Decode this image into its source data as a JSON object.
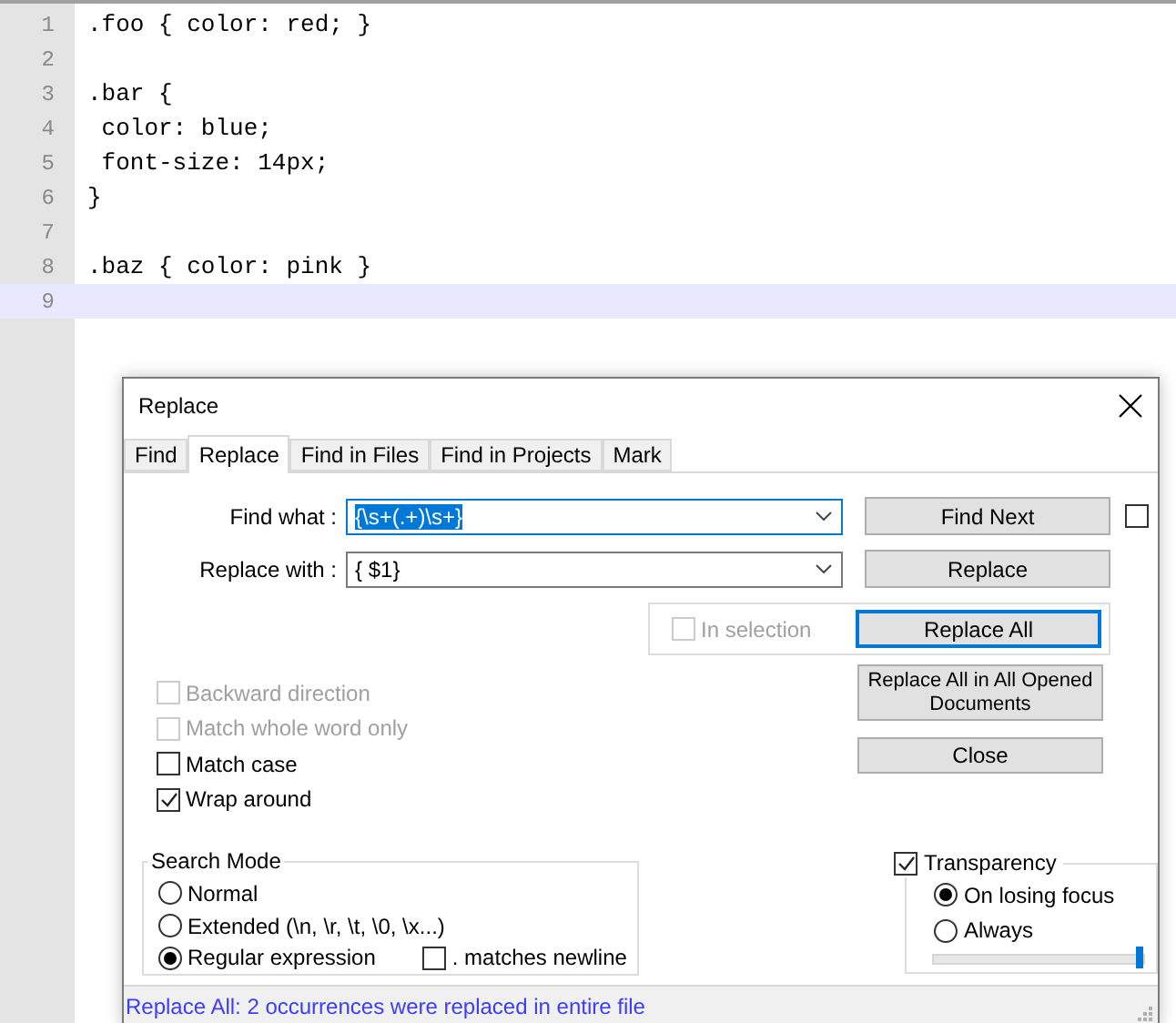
{
  "editor": {
    "lines": [
      {
        "number": "1",
        "text": ".foo { color: red; }",
        "current": false
      },
      {
        "number": "2",
        "current": false
      },
      {
        "number": "3",
        "text": ".bar {",
        "current": false
      },
      {
        "number": "4",
        "text": " color: blue;",
        "current": false
      },
      {
        "number": "5",
        "text": " font-size: 14px;",
        "current": false
      },
      {
        "number": "6",
        "text": "}",
        "current": false
      },
      {
        "number": "7",
        "current": false
      },
      {
        "number": "8",
        "text": ".baz { color: pink }",
        "current": false
      },
      {
        "number": "9",
        "current": true
      }
    ]
  },
  "dialog": {
    "title": "Replace",
    "tabs": [
      {
        "label": "Find",
        "selected": false
      },
      {
        "label": "Replace",
        "selected": true
      },
      {
        "label": "Find in Files",
        "selected": false
      },
      {
        "label": "Find in Projects",
        "selected": false
      },
      {
        "label": "Mark",
        "selected": false
      }
    ],
    "fields": [
      {
        "label": "Find what :",
        "value": "{\\s+(.+)\\s+}",
        "focused": true
      },
      {
        "label": "Replace with :",
        "value": "{ $1}",
        "focused": false
      }
    ],
    "find_next_button": "Find Next",
    "find_next_checkbox": {
      "checked": false
    },
    "replace_button": "Replace",
    "in_selection": {
      "label": "In selection",
      "checked": false,
      "disabled": true
    },
    "replace_all_button": "Replace All",
    "replace_all_opened_button": "Replace All in All Opened Documents",
    "close_button": "Close",
    "options": [
      {
        "label": "Backward direction",
        "checked": false,
        "disabled": true
      },
      {
        "label": "Match whole word only",
        "checked": false,
        "disabled": true
      },
      {
        "label": "Match case",
        "checked": false,
        "disabled": false
      },
      {
        "label": "Wrap around",
        "checked": true,
        "disabled": false
      }
    ],
    "search_mode": {
      "title": "Search Mode",
      "modes": [
        {
          "label": "Normal",
          "selected": false
        },
        {
          "label": "Extended (\\n, \\r, \\t, \\0, \\x...)",
          "selected": false
        },
        {
          "label": "Regular expression",
          "selected": true
        }
      ],
      "matches_newline": {
        "label": ". matches newline",
        "checked": false
      }
    },
    "transparency": {
      "label": "Transparency",
      "checked": true,
      "modes": [
        {
          "label": "On losing focus",
          "selected": true
        },
        {
          "label": "Always",
          "selected": false
        }
      ],
      "level": 1
    },
    "status": "Replace All: 2 occurrences were replaced in entire file"
  }
}
